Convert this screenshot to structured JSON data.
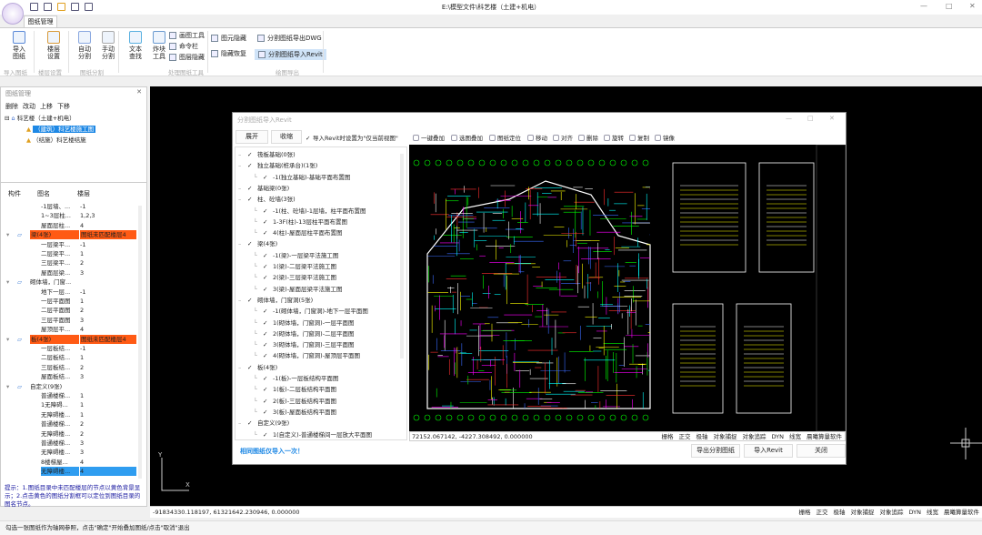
{
  "window": {
    "title": "E:\\模型文件\\科艺楼（土建+机电）",
    "tab": "图纸管理"
  },
  "ribbon": {
    "buttons": [
      {
        "label1": "导入",
        "label2": "图纸",
        "icon": "import-drawing-icon"
      },
      {
        "label1": "楼层",
        "label2": "设置",
        "icon": "floor-settings-icon"
      },
      {
        "label1": "自动",
        "label2": "分割",
        "icon": "auto-split-icon"
      },
      {
        "label1": "手动",
        "label2": "分割",
        "icon": "manual-split-icon"
      },
      {
        "label1": "文本",
        "label2": "查找",
        "icon": "text-search-icon"
      },
      {
        "label1": "炸块",
        "label2": "工具",
        "icon": "explode-block-icon"
      }
    ],
    "small": [
      "画图工具",
      "命令栏",
      "图层隐藏",
      "图元隐藏",
      "隐藏恢复",
      "分割图纸导出DWG",
      "分割图纸导入Revit"
    ],
    "groups": [
      "导入图纸",
      "楼层设置",
      "图纸分割",
      "处理图纸工具",
      "绘图导出"
    ]
  },
  "left_panel": {
    "title": "图纸管理",
    "toolbar": [
      "删除",
      "改动",
      "上移",
      "下移"
    ],
    "tree": {
      "root": "科艺楼（土建+机电）",
      "children": [
        "（建筑）科艺楼施工图",
        "（结施）科艺楼结施"
      ]
    },
    "columns": [
      "构件",
      "图名",
      "楼层"
    ],
    "rows": [
      {
        "name": "-1层墙、...",
        "floor": "-1"
      },
      {
        "name": "1~3层柱...",
        "floor": "1,2,3"
      },
      {
        "name": "屋面层柱...",
        "floor": "4"
      },
      {
        "group": "梁(4张)",
        "name": "",
        "floor": "图纸未匹配楼层4",
        "warn": true,
        "icon": "beam-icon"
      },
      {
        "name": "一层梁平...",
        "floor": "-1"
      },
      {
        "name": "二层梁平...",
        "floor": "1"
      },
      {
        "name": "三层梁平...",
        "floor": "2"
      },
      {
        "name": "屋面层梁...",
        "floor": "3"
      },
      {
        "group": "砌体墙，门窗...",
        "name": "",
        "floor": "",
        "icon": "wall-icon"
      },
      {
        "name": "地下一层...",
        "floor": "-1"
      },
      {
        "name": "一层平面图",
        "floor": "1"
      },
      {
        "name": "二层平面图",
        "floor": "2"
      },
      {
        "name": "三层平面图",
        "floor": "3"
      },
      {
        "name": "屋顶层平...",
        "floor": "4"
      },
      {
        "group": "板(4张)",
        "name": "",
        "floor": "图纸未匹配楼层4",
        "warn": true,
        "icon": "slab-icon"
      },
      {
        "name": "一层板结...",
        "floor": "-1"
      },
      {
        "name": "二层板结...",
        "floor": "1"
      },
      {
        "name": "三层板结...",
        "floor": "2"
      },
      {
        "name": "屋面板结...",
        "floor": "3"
      },
      {
        "group": "自定义(9张)",
        "name": "",
        "floor": "",
        "icon": "custom-icon"
      },
      {
        "name": "普通楼梯...",
        "floor": "1"
      },
      {
        "name": "1无障碍...",
        "floor": "1"
      },
      {
        "name": "无障碍楼...",
        "floor": "1"
      },
      {
        "name": "普通楼梯...",
        "floor": "2"
      },
      {
        "name": "无障碍楼...",
        "floor": "2"
      },
      {
        "name": "普通楼梯...",
        "floor": "3"
      },
      {
        "name": "无障碍楼...",
        "floor": "3"
      },
      {
        "name": "8楼梯屋...",
        "floor": "4"
      },
      {
        "name": "无障碍楼...",
        "floor": "4",
        "selected": true
      }
    ],
    "hint": "提示：1.图纸目录中未匹配楼层的节点以黄色背景显示；2.点击黄色的图纸分割框可以定位到图纸目录的图名节点。"
  },
  "dialog": {
    "title": "分割图纸导入Revit",
    "expand": "展开",
    "collapse": "收缩",
    "checkbox_label": "导入Revit时设置为\"仅当前视图\"",
    "toolbar": [
      "一键叠加",
      "选图叠加",
      "图纸定位",
      "移动",
      "对齐",
      "删除",
      "旋转",
      "复制",
      "镜像"
    ],
    "tree": [
      {
        "t": "筏板基础(0张)",
        "l": 0
      },
      {
        "t": "独立基础(桩承台)(1张)",
        "l": 0
      },
      {
        "t": "-1(独立基础)-基础平面布置图",
        "l": 1
      },
      {
        "t": "基础梁(0张)",
        "l": 0
      },
      {
        "t": "柱、砼墙(3张)",
        "l": 0
      },
      {
        "t": "-1(柱、砼墙)-1层墙，柱平面布置图",
        "l": 1
      },
      {
        "t": "1-3F(柱)-13层柱平面布置图",
        "l": 1
      },
      {
        "t": "4(柱)-屋面层柱平面布置图",
        "l": 1
      },
      {
        "t": "梁(4张)",
        "l": 0
      },
      {
        "t": "-1(梁)-一层梁平法施工图",
        "l": 1
      },
      {
        "t": "1(梁)-二层梁平法施工图",
        "l": 1
      },
      {
        "t": "2(梁)-三层梁平法施工图",
        "l": 1
      },
      {
        "t": "3(梁)-屋面层梁平法施工图",
        "l": 1
      },
      {
        "t": "砌体墙，门窗洞(5张)",
        "l": 0
      },
      {
        "t": "-1(砌体墙，门窗洞)-地下一层平面图",
        "l": 1
      },
      {
        "t": "1(砌体墙，门窗洞)-一层平面图",
        "l": 1
      },
      {
        "t": "2(砌体墙，门窗洞)-二层平面图",
        "l": 1
      },
      {
        "t": "3(砌体墙，门窗洞)-三层平面图",
        "l": 1
      },
      {
        "t": "4(砌体墙，门窗洞)-屋顶层平面图",
        "l": 1
      },
      {
        "t": "板(4张)",
        "l": 0
      },
      {
        "t": "-1(板)-一层板结构平面图",
        "l": 1
      },
      {
        "t": "1(板)-二层板结构平面图",
        "l": 1
      },
      {
        "t": "2(板)-三层板结构平面图",
        "l": 1
      },
      {
        "t": "3(板)-屋面板结构平面图",
        "l": 1
      },
      {
        "t": "自定义(9张)",
        "l": 0
      },
      {
        "t": "1(自定义)-普通楼梯间一层放大平面图",
        "l": 1
      }
    ],
    "note": "相同图纸仅导入一次！",
    "coords": "72152.067142,  -4227.308492,  0.000000",
    "status": [
      "栅格",
      "正交",
      "极轴",
      "对象捕捉",
      "对象追踪",
      "DYN",
      "线宽",
      "晨曦算量软件"
    ],
    "buttons": [
      "导出分割图纸",
      "导入Revit",
      "关闭"
    ]
  },
  "main_status": {
    "coords": "-91834330.118197,  61321642.230946,  0.000000",
    "items": [
      "栅格",
      "正交",
      "极轴",
      "对象捕捉",
      "对象追踪",
      "DYN",
      "线宽",
      "晨曦算量软件"
    ]
  },
  "bottom_hint": "勾选一张图纸作为轴网参照，点击\"确定\"开始叠加图纸/点击\"取消\"退出",
  "colors": {
    "warn": "#ff5a14",
    "selected": "#2f9df0",
    "canvas": "#000000",
    "note": "#1e88e5"
  }
}
